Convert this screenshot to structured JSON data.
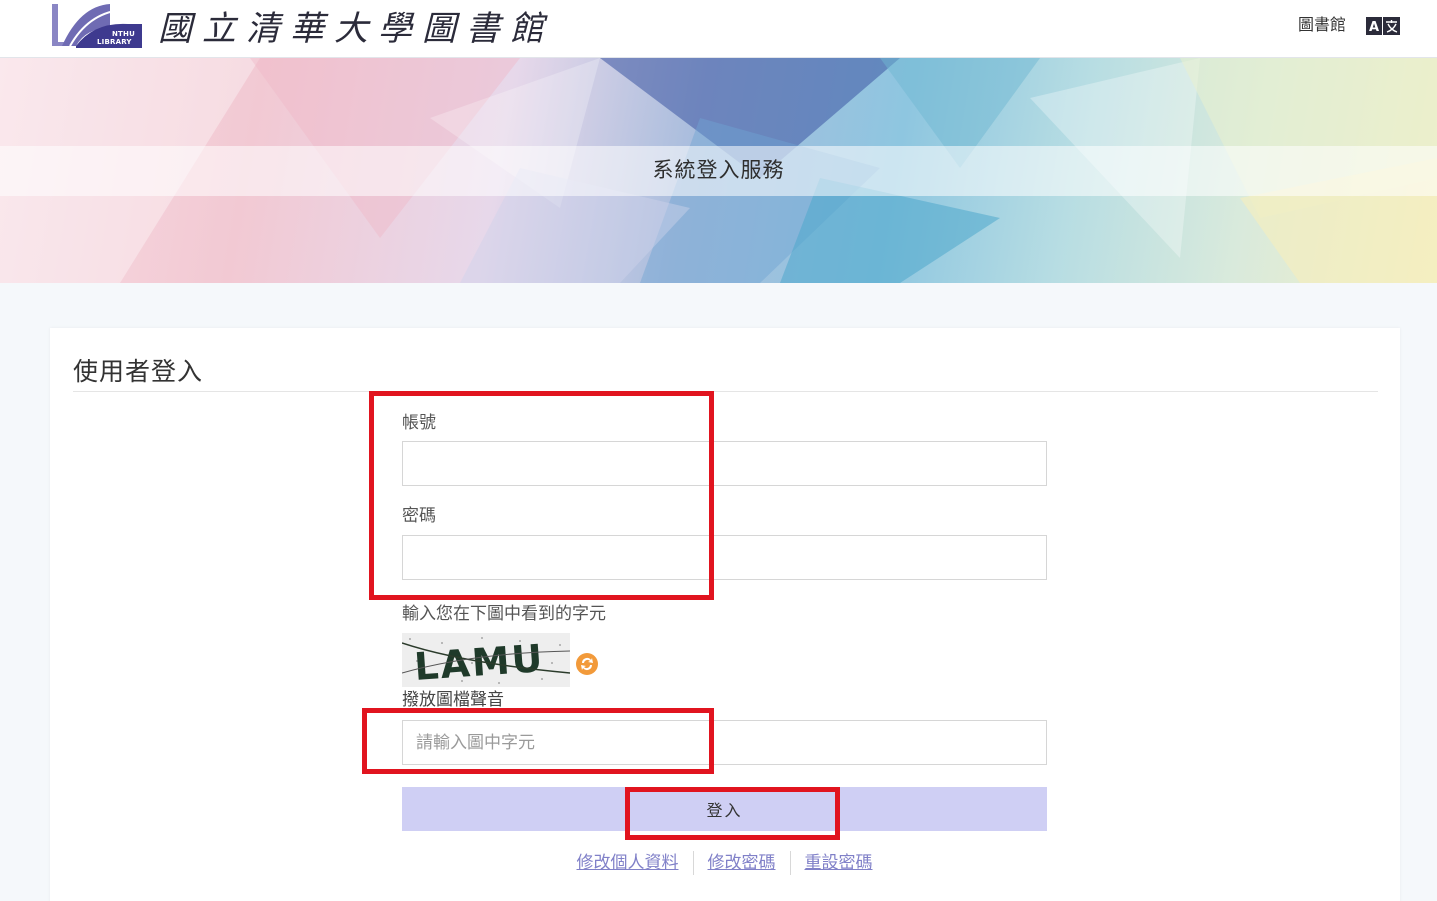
{
  "header": {
    "logo_text_top": "NTHU",
    "logo_text_bottom": "LIBRARY",
    "site_title": "國立清華大學圖書館",
    "library_link": "圖書館",
    "language_icon": "translate-icon"
  },
  "banner": {
    "title": "系統登入服務"
  },
  "login": {
    "heading": "使用者登入",
    "account_label": "帳號",
    "account_value": "",
    "password_label": "密碼",
    "password_value": "",
    "captcha_prompt": "輸入您在下圖中看到的字元",
    "captcha_text": "LAMU",
    "refresh_icon": "refresh-icon",
    "audio_link": "撥放圖檔聲音",
    "captcha_placeholder": "請輸入圖中字元",
    "submit_label": "登入",
    "links": {
      "edit_profile": "修改個人資料",
      "change_password": "修改密碼",
      "reset_password": "重設密碼"
    }
  },
  "colors": {
    "highlight": "#e1141f",
    "button": "#cfcff4",
    "link": "#8080c8"
  }
}
